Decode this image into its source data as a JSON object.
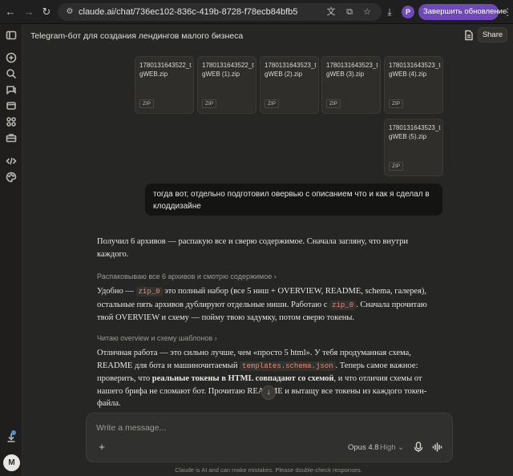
{
  "browser": {
    "url": "claude.ai/chat/736ec102-836c-419b-8728-f78ecb84bfb5",
    "profile_initial": "P",
    "update_label": "Завершить обновление"
  },
  "sidebar": {
    "avatar_initial": "M"
  },
  "header": {
    "title": "Telegram-бот для создания лендингов малого бизнеса",
    "share_label": "Share"
  },
  "attachments": [
    {
      "name": "1780131643522_tgWEB.zip",
      "type": "ZIP"
    },
    {
      "name": "1780131643522_tgWEB (1).zip",
      "type": "ZIP"
    },
    {
      "name": "1780131643523_tgWEB (2).zip",
      "type": "ZIP"
    },
    {
      "name": "1780131643523_tgWEB (3).zip",
      "type": "ZIP"
    },
    {
      "name": "1780131643523_tgWEB (4).zip",
      "type": "ZIP"
    },
    {
      "name": "1780131643523_tgWEB (5).zip",
      "type": "ZIP"
    }
  ],
  "user_message": "тогда вот, отдельно подготовил овервью с описанием что и как я сделал в клоддизайне",
  "assistant": {
    "intro": "Получил 6 архивов — распакую все и сверю содержимое. Сначала загляну, что внутри каждого.",
    "step1": "Распаковываю все 6 архивов и смотрю содержимое",
    "p1_a": "Удобно — ",
    "p1_code1": "zip_0",
    "p1_b": " это полный набор (все 5 ниш + OVERVIEW, README, schema, галерея), остальные пять архивов дублируют отдельные ниши. Работаю с ",
    "p1_code2": "zip_0",
    "p1_c": ". Сначала прочитаю твой OVERVIEW и схему — пойму твою задумку, потом сверю токены.",
    "step2": "Читаю overview и схему шаблонов",
    "p2_a": "Отличная работа — это сильно лучше, чем «просто 5 html». У тебя продуманная схема, README для бота и машиночитаемый ",
    "p2_code": "templates.schema.json",
    "p2_b": ". Теперь самое важное: проверить, что ",
    "p2_bold": "реальные токены в HTML совпадают со схемой",
    "p2_c": ", и что отличия схемы от нашего брифа не сломают бот. Прочитаю README и вытащу все токены из каждого токен-файла."
  },
  "composer": {
    "placeholder": "Write a message...",
    "model": "Opus 4.8",
    "effort": "High"
  },
  "disclaimer": "Claude is AI and can make mistakes. Please double-check responses."
}
